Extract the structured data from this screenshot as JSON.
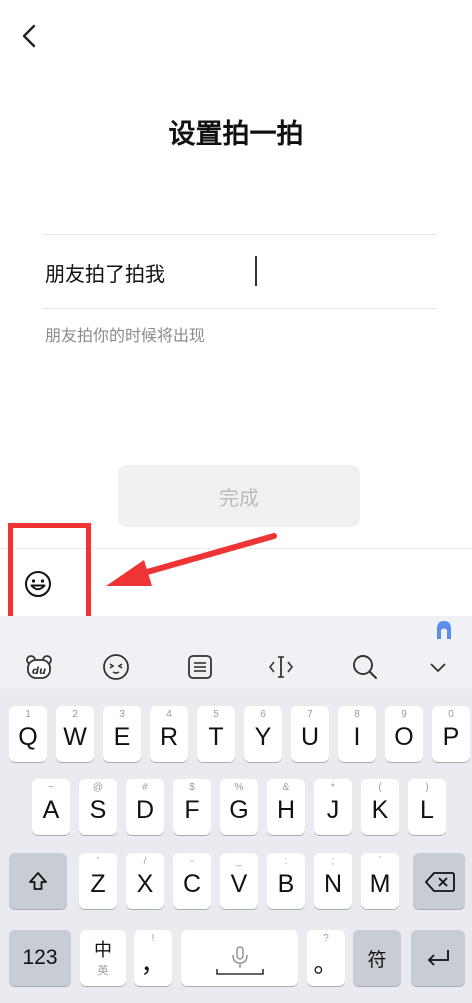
{
  "header": {
    "title": "设置拍一拍"
  },
  "form": {
    "value": "朋友拍了拍我",
    "hint": "朋友拍你的时候将出现",
    "done_label": "完成"
  },
  "emoji_bar": {
    "icon": "smiley-icon"
  },
  "keyboard": {
    "toolbar_icons": [
      "du-bear-icon",
      "face-icon",
      "clipboard-icon",
      "cursor-move-icon",
      "search-icon",
      "chevron-down-icon"
    ],
    "row1": [
      {
        "main": "Q",
        "sub": "1"
      },
      {
        "main": "W",
        "sub": "2"
      },
      {
        "main": "E",
        "sub": "3"
      },
      {
        "main": "R",
        "sub": "4"
      },
      {
        "main": "T",
        "sub": "5"
      },
      {
        "main": "Y",
        "sub": "6"
      },
      {
        "main": "U",
        "sub": "7"
      },
      {
        "main": "I",
        "sub": "8"
      },
      {
        "main": "O",
        "sub": "9"
      },
      {
        "main": "P",
        "sub": "0"
      }
    ],
    "row2": [
      {
        "main": "A",
        "sub": "~"
      },
      {
        "main": "S",
        "sub": "@"
      },
      {
        "main": "D",
        "sub": "#"
      },
      {
        "main": "F",
        "sub": "$"
      },
      {
        "main": "G",
        "sub": "%"
      },
      {
        "main": "H",
        "sub": "&"
      },
      {
        "main": "J",
        "sub": "*"
      },
      {
        "main": "K",
        "sub": "("
      },
      {
        "main": "L",
        "sub": ")"
      }
    ],
    "row3": [
      {
        "main": "Z",
        "sub": "'"
      },
      {
        "main": "X",
        "sub": "/"
      },
      {
        "main": "C",
        "sub": "-"
      },
      {
        "main": "V",
        "sub": "_"
      },
      {
        "main": "B",
        "sub": ":"
      },
      {
        "main": "N",
        "sub": ";"
      },
      {
        "main": "M",
        "sub": "`"
      }
    ],
    "row4": {
      "numbers": "123",
      "lang_main": "中",
      "lang_sub": "英",
      "comma": "，",
      "comma_sub": "!",
      "period": "。",
      "period_sub": "?",
      "symbol": "符"
    }
  }
}
